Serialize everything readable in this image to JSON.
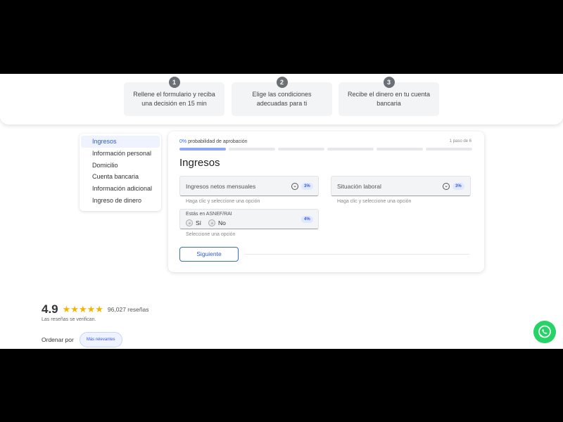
{
  "steps": [
    {
      "num": "1",
      "line1": "Rellene el formulario y reciba",
      "line2": "una decisión en 15 min"
    },
    {
      "num": "2",
      "line1": "Elige las condiciones",
      "line2": "adecuadas para ti"
    },
    {
      "num": "3",
      "line1": "Recibe el dinero en tu cuenta",
      "line2": "bancaria"
    }
  ],
  "sidebar": {
    "items": [
      {
        "label": "Ingresos",
        "active": true
      },
      {
        "label": "Información personal"
      },
      {
        "label": "Domicilio"
      },
      {
        "label": "Cuenta bancaria"
      },
      {
        "label": "Información adicional"
      },
      {
        "label": "Ingreso de dinero"
      }
    ]
  },
  "form": {
    "probability_pct": "0%",
    "probability_label": " probabilidad de aprobación",
    "step_of": "1 paso de 6",
    "progress_segments": 6,
    "progress_filled": 1,
    "title": "Ingresos",
    "income_field": {
      "label": "Ingresos netos mensuales",
      "badge": "3%",
      "hint": "Haga clic y seleccione una opción"
    },
    "employment_field": {
      "label": "Situación laboral",
      "badge": "3%",
      "hint": "Haga clic y seleccione una opción"
    },
    "asnef_field": {
      "label": "Estás en ASNEF/RAI",
      "badge": "4%",
      "option_yes": "Sí",
      "option_no": "No",
      "hint": "Seleccione una opción"
    },
    "next_button": "Siguiente"
  },
  "reviews": {
    "score": "4.9",
    "stars": "★★★★★",
    "count": "96,027 reseñas",
    "verified_note": "Las reseñas se verifican.",
    "sort_label": "Ordenar por",
    "sort_value": "Más relevantes"
  },
  "colors": {
    "accent": "#2f5bd9",
    "whatsapp": "#25d366",
    "star": "#f5b400"
  },
  "icons": {
    "chevron": "chevron-down-icon",
    "whatsapp": "whatsapp-icon",
    "star": "star-icon"
  }
}
